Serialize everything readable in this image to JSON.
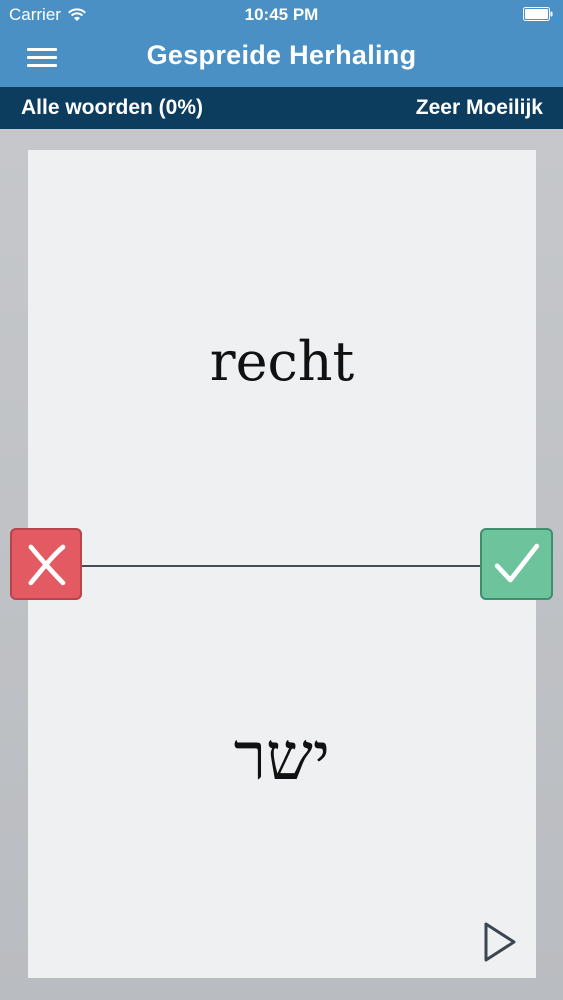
{
  "status_bar": {
    "carrier": "Carrier",
    "time": "10:45 PM",
    "wifi_icon": "wifi-icon",
    "battery_icon": "battery-icon"
  },
  "nav": {
    "title": "Gespreide Herhaling",
    "menu_icon": "hamburger-menu-icon"
  },
  "subbar": {
    "list_label": "Alle woorden (0%)",
    "difficulty_label": "Zeer Moeilijk"
  },
  "card": {
    "front_word": "recht",
    "back_word": "ישר",
    "wrong_icon": "close-icon",
    "correct_icon": "checkmark-icon",
    "play_icon": "play-icon"
  },
  "colors": {
    "header": "#4a90c4",
    "subbar": "#0d3d5e",
    "wrong": "#e45a63",
    "correct": "#6cc39c"
  }
}
